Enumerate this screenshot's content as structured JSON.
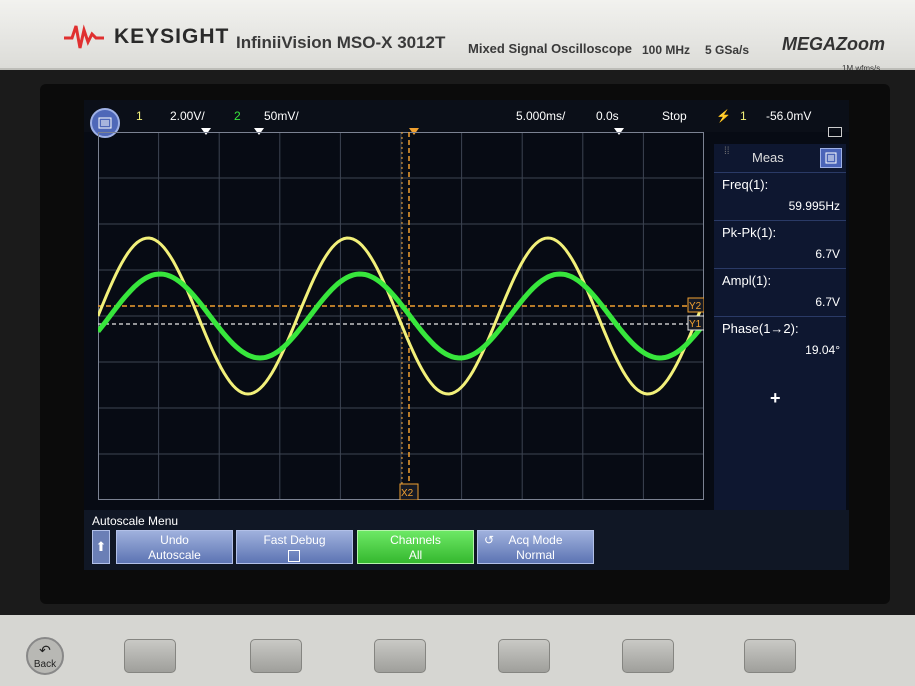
{
  "header": {
    "brand": "KEYSIGHT",
    "model": "InfiniiVision MSO-X 3012T",
    "description": "Mixed Signal Oscilloscope",
    "bandwidth": "100 MHz",
    "sample_rate": "5 GSa/s",
    "megazoom": "MEGAZoom",
    "megazoom_sub": "1M wfms/s"
  },
  "status": {
    "ch1_num": "1",
    "ch1_scale": "2.00V/",
    "ch2_num": "2",
    "ch2_scale": "50mV/",
    "timebase": "5.000ms/",
    "delay": "0.0s",
    "run_state": "Stop",
    "trigger_source": "1",
    "trigger_level": "-56.0mV"
  },
  "markers": {
    "ch2": "2",
    "ch1": "1",
    "y2": "Y2",
    "y1": "Y1",
    "x2": "X2",
    "t": "T"
  },
  "measurements": {
    "title": "Meas",
    "items": [
      {
        "name": "Freq(1):",
        "value": "59.995Hz"
      },
      {
        "name": "Pk-Pk(1):",
        "value": "6.7V"
      },
      {
        "name": "Ampl(1):",
        "value": "6.7V"
      },
      {
        "name": "Phase(1→2):",
        "value": "19.04°"
      }
    ],
    "add": "+"
  },
  "softkeys": {
    "menu_title": "Autoscale Menu",
    "keys": [
      {
        "line1": "Undo",
        "line2": "Autoscale"
      },
      {
        "line1": "Fast Debug",
        "line2": ""
      },
      {
        "line1": "Channels",
        "line2": "All"
      },
      {
        "line1": "Acq Mode",
        "line2": "Normal"
      }
    ]
  },
  "panel": {
    "back": "Back"
  },
  "colors": {
    "ch1": "#f2f07a",
    "ch2": "#37e63c",
    "cursor": "#f0a030",
    "grid": "#3d4452"
  }
}
